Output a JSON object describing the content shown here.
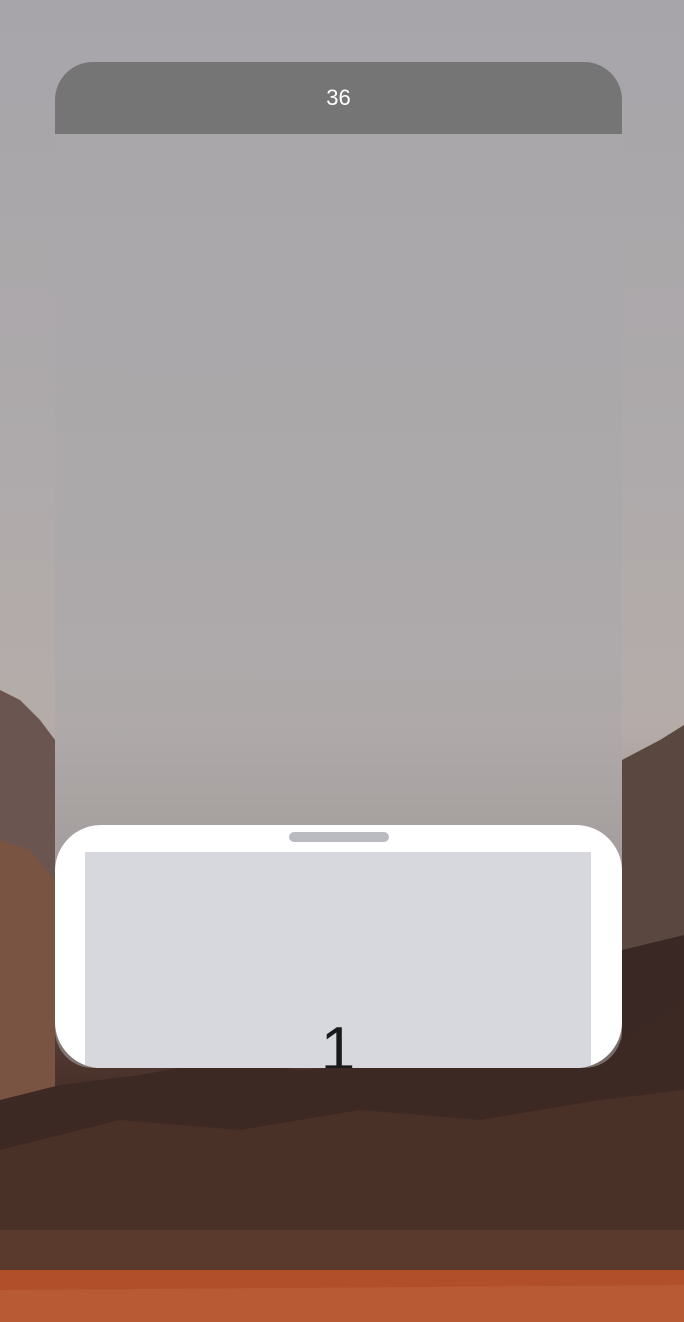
{
  "header": {
    "counter": "36"
  },
  "sheet": {
    "number": "1"
  },
  "colors": {
    "header_bg": "#757575",
    "sheet_bg": "#ffffff",
    "sheet_content_bg": "#d6d8dd",
    "handle": "#babbc0"
  }
}
